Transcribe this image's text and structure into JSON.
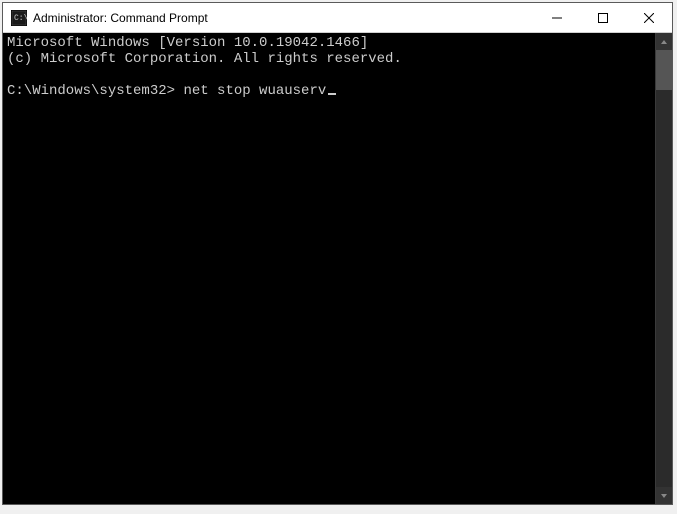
{
  "window": {
    "title": "Administrator: Command Prompt"
  },
  "terminal": {
    "version_line": "Microsoft Windows [Version 10.0.19042.1466]",
    "copyright_line": "(c) Microsoft Corporation. All rights reserved.",
    "prompt": "C:\\Windows\\system32>",
    "command": "net stop wuauserv"
  }
}
